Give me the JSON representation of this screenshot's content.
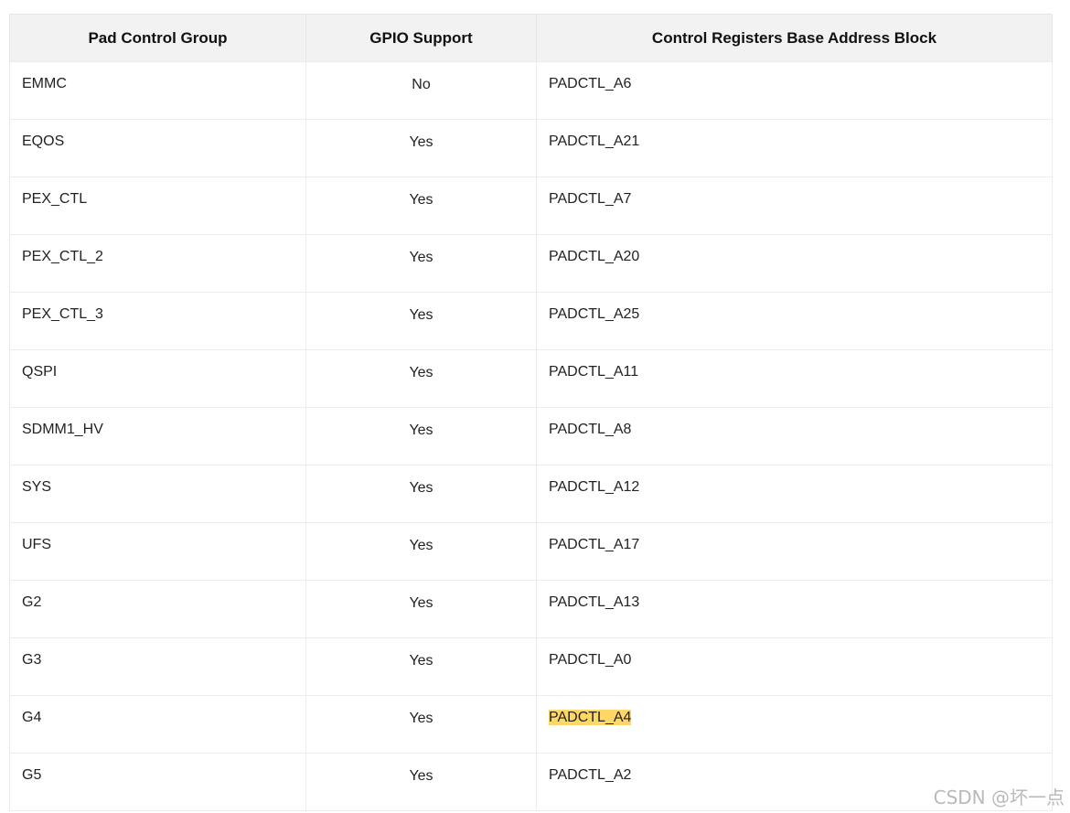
{
  "table": {
    "headers": [
      "Pad Control Group",
      "GPIO Support",
      "Control Registers Base Address Block"
    ],
    "rows": [
      {
        "group": "EMMC",
        "gpio": "No",
        "block": "PADCTL_A6"
      },
      {
        "group": "EQOS",
        "gpio": "Yes",
        "block": "PADCTL_A21"
      },
      {
        "group": "PEX_CTL",
        "gpio": "Yes",
        "block": "PADCTL_A7"
      },
      {
        "group": "PEX_CTL_2",
        "gpio": "Yes",
        "block": "PADCTL_A20"
      },
      {
        "group": "PEX_CTL_3",
        "gpio": "Yes",
        "block": "PADCTL_A25"
      },
      {
        "group": "QSPI",
        "gpio": "Yes",
        "block": "PADCTL_A11"
      },
      {
        "group": "SDMM1_HV",
        "gpio": "Yes",
        "block": "PADCTL_A8"
      },
      {
        "group": "SYS",
        "gpio": "Yes",
        "block": "PADCTL_A12"
      },
      {
        "group": "UFS",
        "gpio": "Yes",
        "block": "PADCTL_A17"
      },
      {
        "group": "G2",
        "gpio": "Yes",
        "block": "PADCTL_A13"
      },
      {
        "group": "G3",
        "gpio": "Yes",
        "block": "PADCTL_A0"
      },
      {
        "group": "G4",
        "gpio": "Yes",
        "block": "PADCTL_A4",
        "highlighted": true
      },
      {
        "group": "G5",
        "gpio": "Yes",
        "block": "PADCTL_A2"
      }
    ]
  },
  "colors": {
    "header_bg": "#f2f2f2",
    "highlight": "#ffd766"
  },
  "watermark": "CSDN @坏一点"
}
